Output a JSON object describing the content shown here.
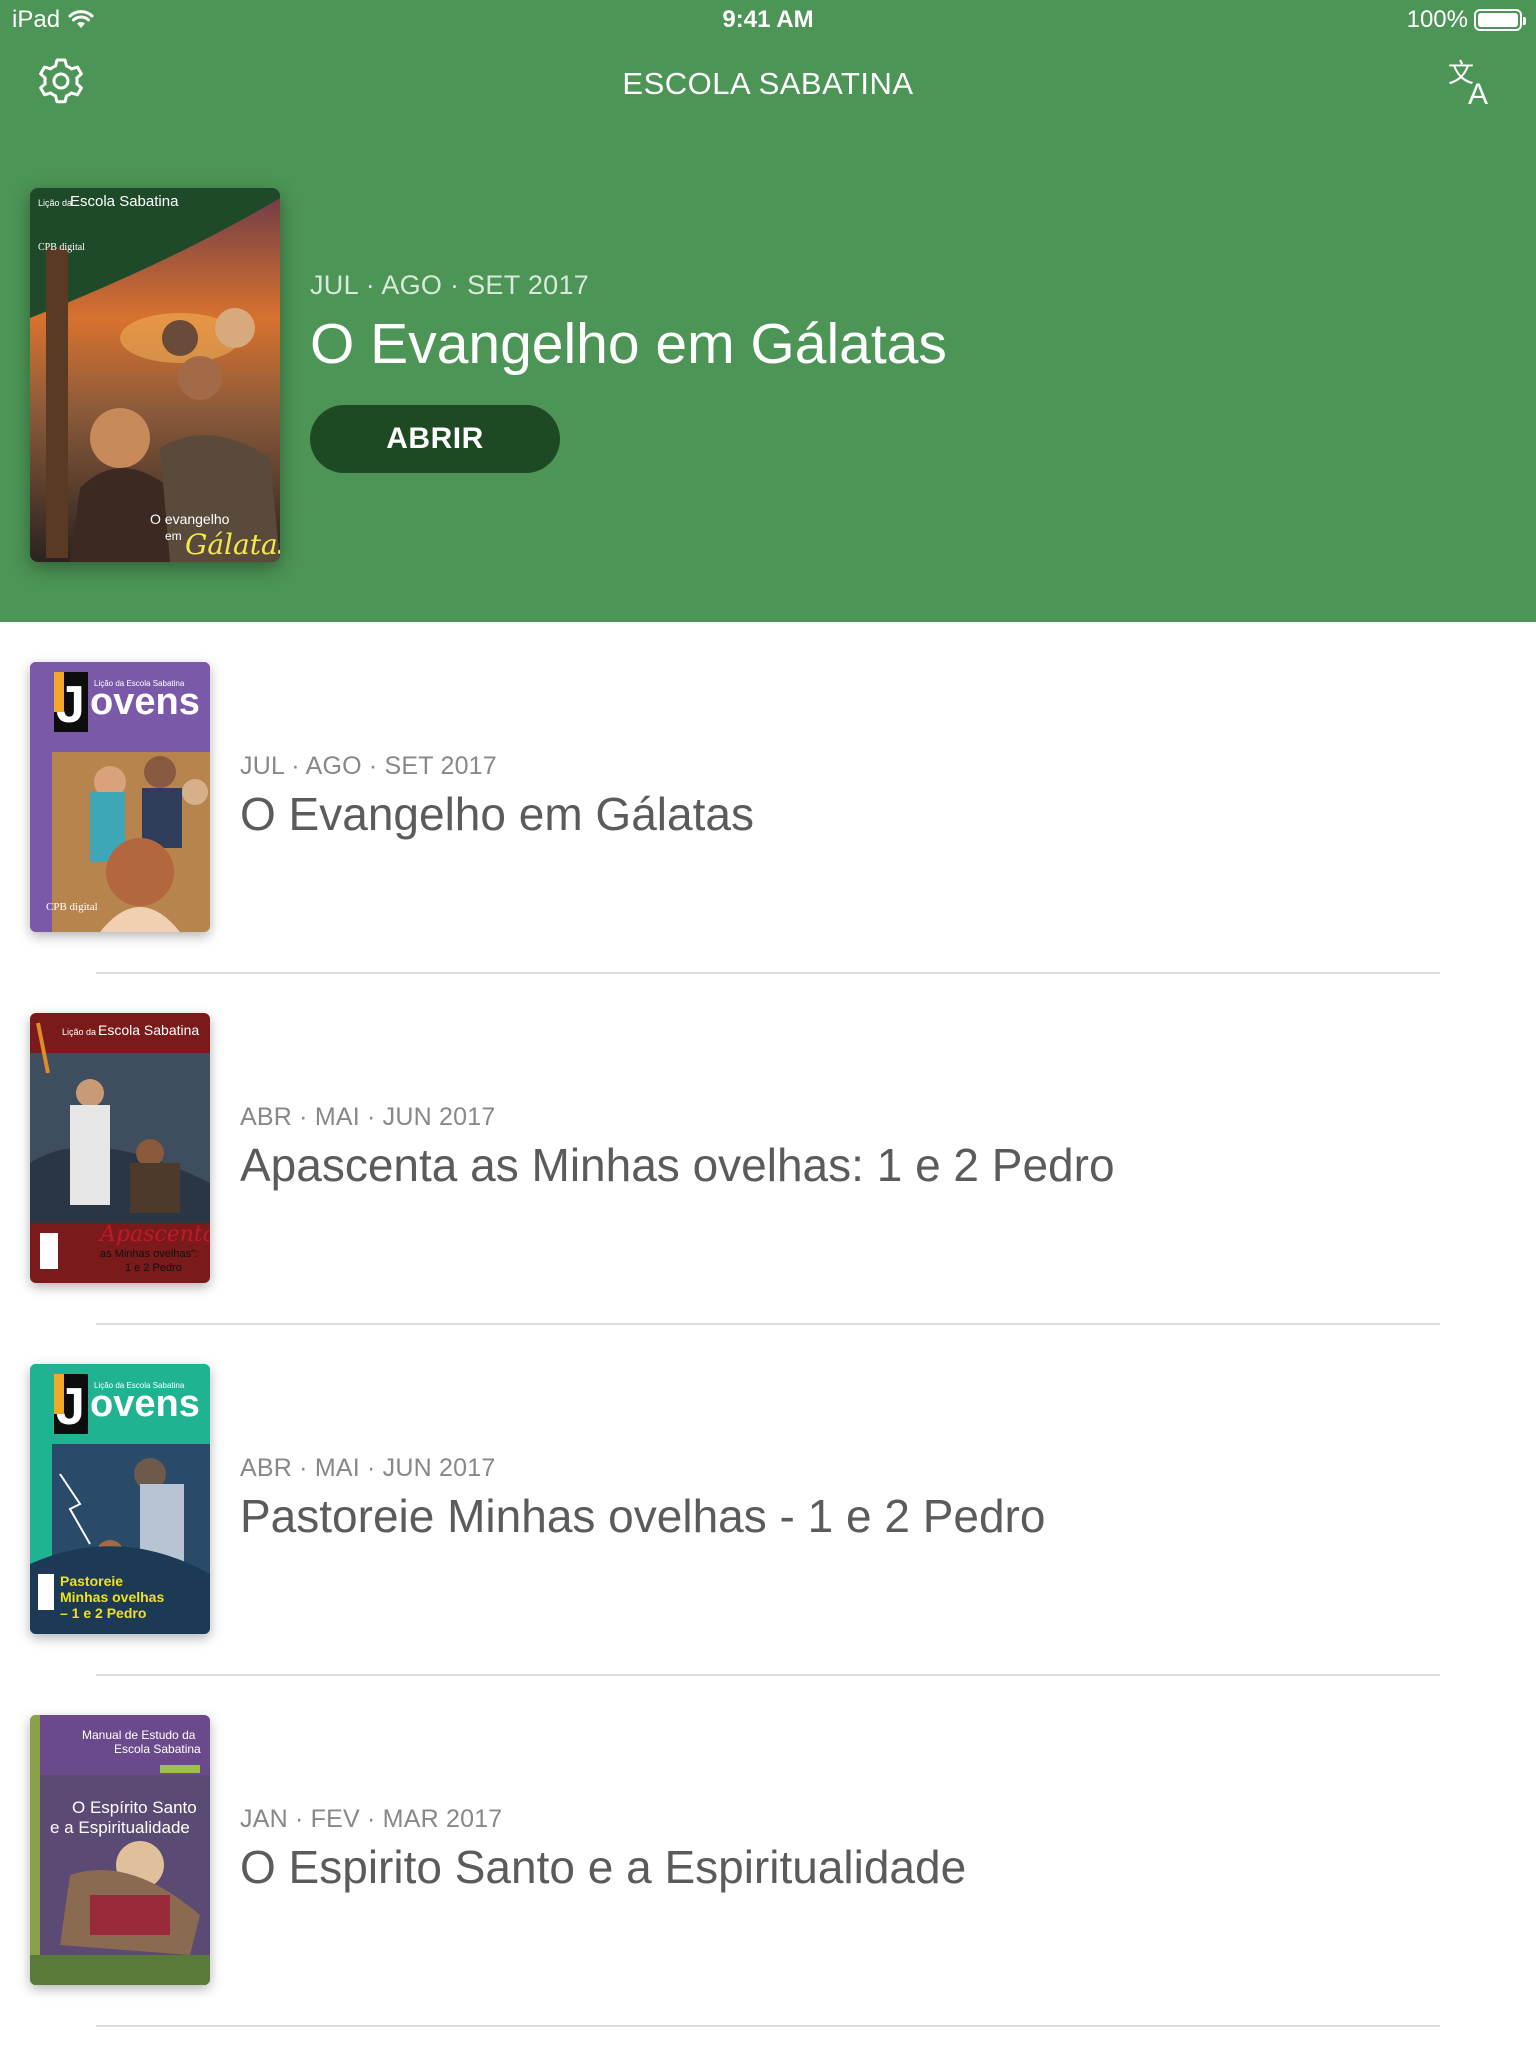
{
  "status_bar": {
    "device": "iPad",
    "time": "9:41 AM",
    "battery": "100%"
  },
  "nav": {
    "title": "ESCOLA SABATINA",
    "settings_icon": "gear-icon",
    "translate_icon": "translate-icon"
  },
  "featured": {
    "quarter": "JUL · AGO · SET 2017",
    "title": "O Evangelho em Gálatas",
    "button": "ABRIR",
    "cover": {
      "header": "Lição da Escola Sabatina",
      "brand": "Escola Sabatina",
      "small": "Lição da",
      "publisher": "CPB digital",
      "caption1": "O evangelho",
      "caption2": "em",
      "caption3": "Gálatas"
    }
  },
  "lessons": [
    {
      "quarter": "JUL · AGO · SET 2017",
      "title": "O Evangelho em Gálatas",
      "cover": {
        "small": "Lição da Escola Sabatina",
        "brand": "ovens",
        "publisher": "CPB digital"
      }
    },
    {
      "quarter": "ABR · MAI · JUN 2017",
      "title": "Apascenta as Minhas ovelhas: 1 e 2 Pedro",
      "cover": {
        "small": "Lição da",
        "brand": "Escola Sabatina",
        "caption1": "Apascenta",
        "caption2": "as Minhas ovelhas\":",
        "caption3": "1 e 2 Pedro"
      }
    },
    {
      "quarter": "ABR · MAI · JUN 2017",
      "title": "Pastoreie Minhas ovelhas - 1 e 2 Pedro",
      "cover": {
        "small": "Lição da Escola Sabatina",
        "brand": "ovens",
        "caption1": "Pastoreie",
        "caption2": "Minhas ovelhas",
        "caption3": "– 1 e 2 Pedro"
      }
    },
    {
      "quarter": "JAN · FEV · MAR 2017",
      "title": "O Espirito Santo e a Espiritualidade",
      "cover": {
        "small": "Manual de Estudo da",
        "brand": "Escola Sabatina",
        "caption1": "O Espírito Santo",
        "caption2": "e a Espiritualidade"
      }
    }
  ]
}
